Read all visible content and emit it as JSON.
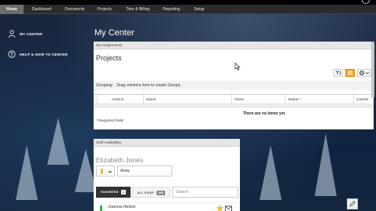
{
  "nav": {
    "items": [
      "Home",
      "Dashboard",
      "Documents",
      "Projects",
      "Time & Billing",
      "Reporting",
      "Setup"
    ],
    "active": "Home"
  },
  "sidebar": {
    "items": [
      {
        "label": "MY CENTER",
        "icon": "user-icon"
      },
      {
        "label": "HELP & HOW TO CENTER",
        "icon": "help-icon"
      }
    ]
  },
  "page": {
    "title": "My Center"
  },
  "assignments": {
    "header": "My Assignments",
    "title": "Projects",
    "grouping_label": "Grouping:",
    "grouping_hint": "Drag columns here to create Groups",
    "columns": [
      "Actions",
      "Name",
      "Client",
      "Status *",
      "Current"
    ],
    "empty_text": "There are no items yet.",
    "required_note": "* Required Field",
    "toolbar": {
      "filter_icon": "filter-icon",
      "export_icon": "grid-icon",
      "settings_icon": "gear-icon"
    },
    "accent": "#f0a31a"
  },
  "staff": {
    "header": "Staff Availability",
    "name": "Elizabeth Jones",
    "status": "Away",
    "status_color": "#f2b632",
    "tabs": [
      {
        "label": "FAVORITES",
        "count": "1"
      },
      {
        "label": "ALL STAFF",
        "count": "288"
      }
    ],
    "search_placeholder": "Search",
    "people": [
      {
        "name": "Joanna Hetzel",
        "status_color": "#2bb34a"
      }
    ]
  }
}
